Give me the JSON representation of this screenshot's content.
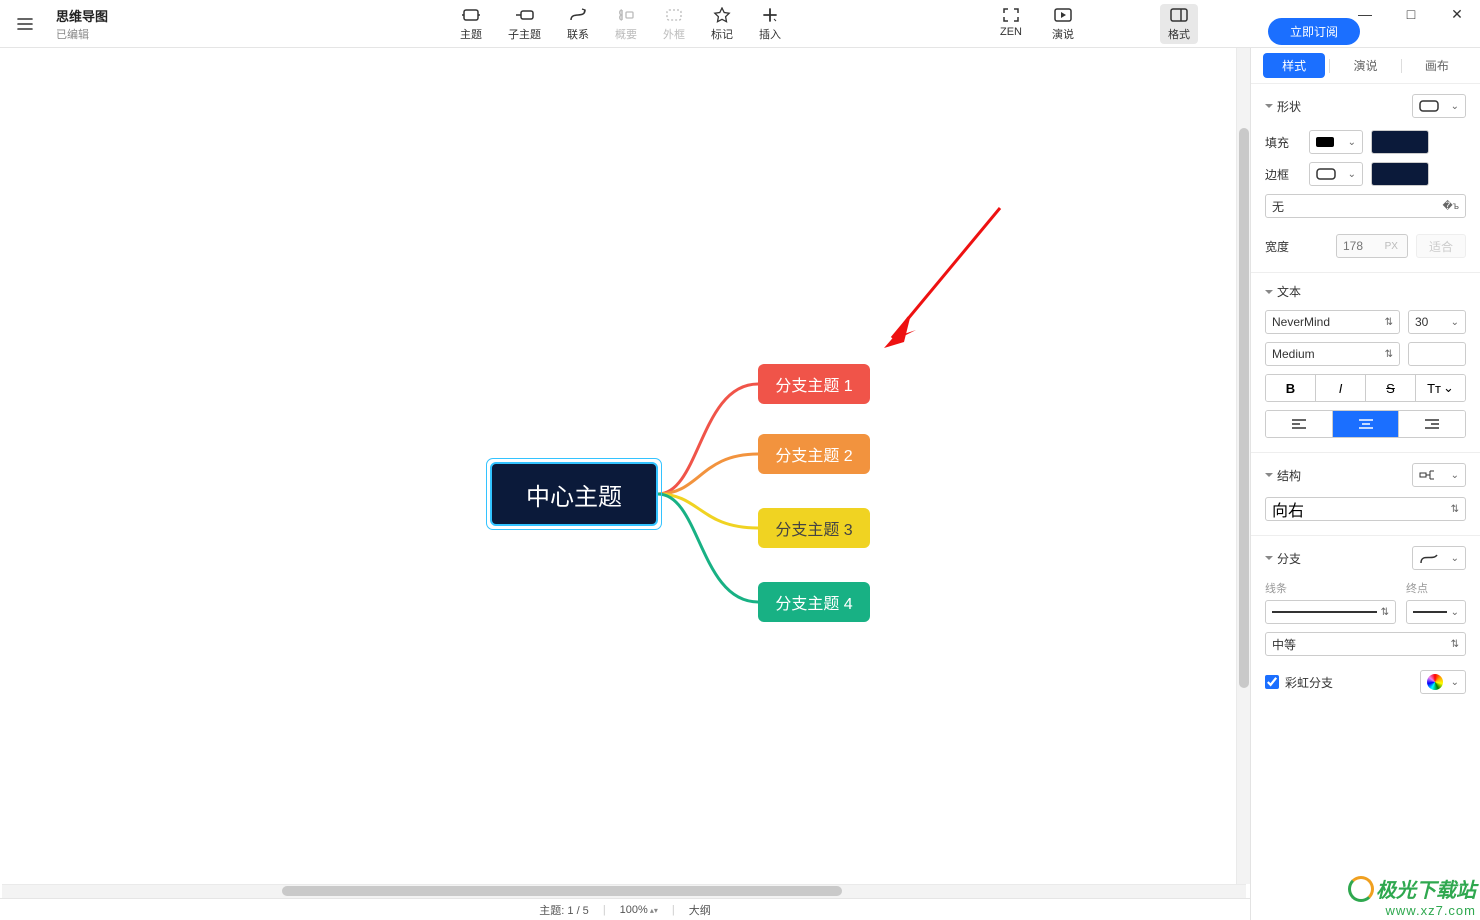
{
  "title": {
    "main": "思维导图",
    "sub": "已编辑"
  },
  "toolbar": {
    "topic": "主题",
    "subtopic": "子主题",
    "relation": "联系",
    "summary": "概要",
    "boundary": "外框",
    "marker": "标记",
    "insert": "插入",
    "zen": "ZEN",
    "present": "演说",
    "format": "格式"
  },
  "subscribe": "立即订阅",
  "window": {
    "min": "—",
    "max": "□",
    "close": "✕"
  },
  "mindmap": {
    "center": "中心主题",
    "branches": [
      "分支主题 1",
      "分支主题 2",
      "分支主题 3",
      "分支主题 4"
    ]
  },
  "panel": {
    "tabs": {
      "style": "样式",
      "present": "演说",
      "canvas": "画布"
    },
    "shape": {
      "label": "形状"
    },
    "fill": {
      "label": "填充"
    },
    "border": {
      "label": "边框",
      "none": "无"
    },
    "width": {
      "label": "宽度",
      "value": "178",
      "unit": "PX",
      "fit": "适合"
    },
    "text": {
      "label": "文本",
      "font": "NeverMind",
      "size": "30",
      "weight": "Medium",
      "bold": "B",
      "italic": "I",
      "strike": "S",
      "case": "Tт"
    },
    "structure": {
      "label": "结构",
      "direction": "向右"
    },
    "branch": {
      "label": "分支",
      "line_label": "线条",
      "end_label": "终点",
      "weight": "中等",
      "rainbow": "彩虹分支"
    }
  },
  "status": {
    "topics": "主题: 1 / 5",
    "zoom": "100%",
    "outline": "大纲"
  },
  "watermark": {
    "brand": "极光下载站",
    "url": "www.xz7.com"
  }
}
